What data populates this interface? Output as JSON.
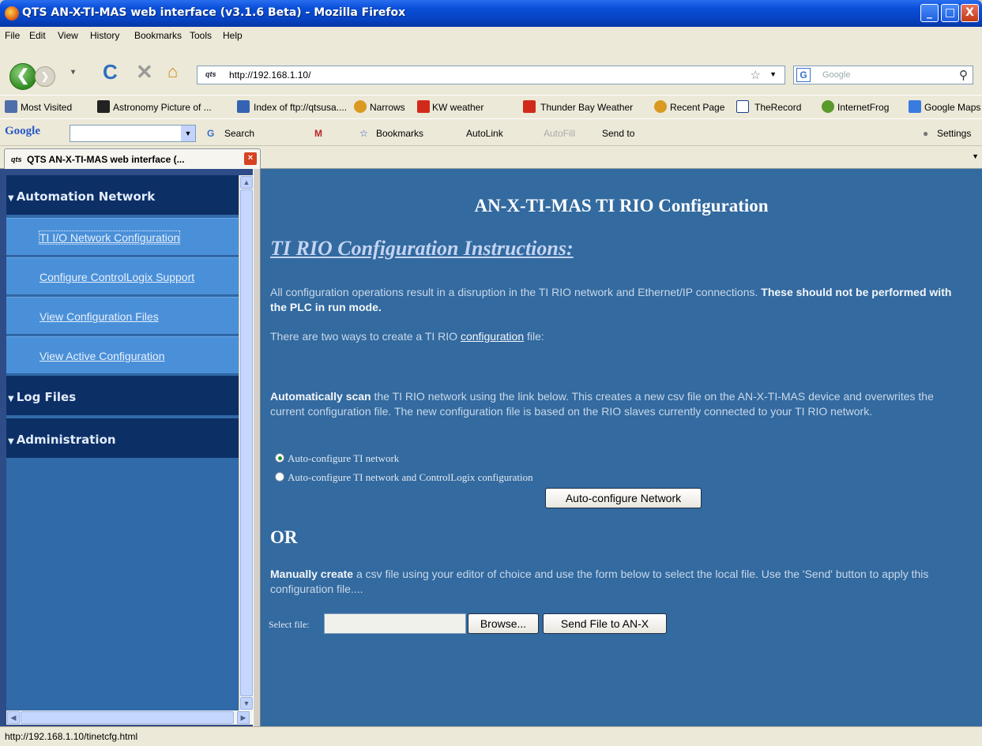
{
  "window": {
    "title": "QTS AN-X-TI-MAS web interface (v3.1.6 Beta) - Mozilla Firefox",
    "controls": [
      "_",
      "□",
      "X"
    ]
  },
  "menu": [
    "File",
    "Edit",
    "View",
    "History",
    "Bookmarks",
    "Tools",
    "Help"
  ],
  "nav": {
    "url": "http://192.168.1.10/",
    "favicon_text": "qts",
    "search_placeholder": "Google"
  },
  "bookmarks": [
    "Most Visited",
    "Astronomy Picture of ...",
    "Index of ftp://qtsusa....",
    "Narrows",
    "KW weather",
    "Thunder Bay Weather",
    "Recent Page",
    "TheRecord",
    "InternetFrog",
    "Google Maps"
  ],
  "google_toolbar": {
    "logo": "Google",
    "search": "Search",
    "bookmarks": "Bookmarks",
    "autolink": "AutoLink",
    "autofill": "AutoFill",
    "sendto": "Send to",
    "settings": "Settings"
  },
  "tab": {
    "label": "QTS AN-X-TI-MAS web interface (...",
    "favicon_text": "qts"
  },
  "sidebar": {
    "sections": [
      {
        "title": "Automation Network",
        "items": [
          "TI I/O Network Configuration",
          "Configure ControlLogix Support",
          "View Configuration Files",
          "View Active Configuration"
        ]
      },
      {
        "title": "Log Files"
      },
      {
        "title": "Administration"
      }
    ]
  },
  "main": {
    "heading": "AN-X-TI-MAS TI RIO Configuration",
    "subheading": "TI RIO Configuration Instructions:",
    "para1_normal": "All configuration operations result in a disruption in the TI RIO network and Ethernet/IP connections. ",
    "para1_bold": "These should not be performed with the PLC in run mode.",
    "para2_before": "There are two ways to create a TI RIO ",
    "para2_link": "configuration",
    "para2_after": " file:",
    "auto_bold": "Automatically scan",
    "auto_text": " the TI RIO network using the link below. This creates a new csv file on the AN-X-TI-MAS device and overwrites the current configuration file. The new configuration file is based on the RIO slaves currently connected to your TI RIO network.",
    "radio1": "Auto-configure TI network",
    "radio2": "Auto-configure TI network and ControlLogix configuration",
    "auto_button": "Auto-configure Network",
    "or_label": "OR",
    "manual_bold": "Manually create",
    "manual_text": " a csv file using your editor of choice and use the form below to select the local file. Use the 'Send' button to apply this configuration file....",
    "file_label": "Select file:",
    "browse_button": "Browse...",
    "send_button": "Send File to AN-X"
  },
  "status": {
    "text": "http://192.168.1.10/tinetcfg.html"
  }
}
